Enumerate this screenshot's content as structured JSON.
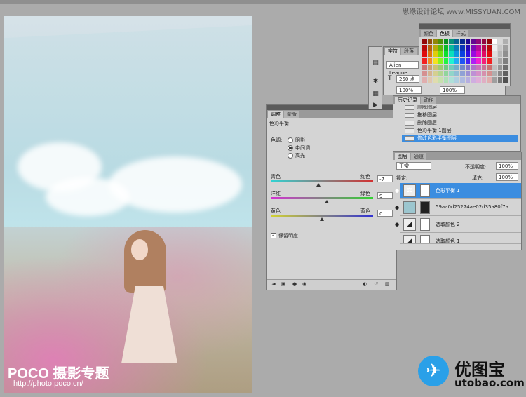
{
  "watermark_top": "思缘设计论坛 www.MISSYUAN.COM",
  "photo": {
    "watermark_brand": "POCO 摄影专题",
    "watermark_url": "http://photo.poco.cn/"
  },
  "adjustments": {
    "tabs": [
      "调整",
      "蒙版"
    ],
    "title": "色彩平衡",
    "tone_label": "色调:",
    "tones": [
      "阴影",
      "中间调",
      "高光"
    ],
    "selected_tone": "中间调",
    "sliders": [
      {
        "left": "青色",
        "right": "红色",
        "value": "-7",
        "color_left": "#31d3d3",
        "color_right": "#d33131",
        "level": -7
      },
      {
        "left": "洋红",
        "right": "绿色",
        "value": "9",
        "color_left": "#d331d3",
        "color_right": "#31d331",
        "level": 9
      },
      {
        "left": "黄色",
        "right": "蓝色",
        "value": "0",
        "color_left": "#d3d331",
        "color_right": "#3131d3",
        "level": 0
      }
    ],
    "preserve_luminosity": "保留明度",
    "preserve_checked": true
  },
  "character": {
    "tabs": [
      "字符",
      "段落"
    ],
    "font": "Alien League",
    "size": "250 点",
    "scale_v": "100%",
    "scale_h": "100%"
  },
  "swatches": {
    "tabs": [
      "颜色",
      "色板",
      "样式"
    ],
    "active_tab": "色板"
  },
  "history": {
    "tabs": [
      "历史记录",
      "动作"
    ],
    "items": [
      "删除图层",
      "拖移图层",
      "删除图层",
      "色彩平衡 1图层",
      "修改色彩平衡图层"
    ],
    "selected_index": 4
  },
  "layers": {
    "tabs": [
      "图层",
      "通道"
    ],
    "blend_mode": "正常",
    "opacity_label": "不透明度:",
    "opacity": "100%",
    "lock_label": "锁定:",
    "fill_label": "填充:",
    "fill": "100%",
    "rows": [
      {
        "name": "色彩平衡 1",
        "selected": true
      },
      {
        "name": "59aa0d25274ae02d35a80f7a",
        "selected": false
      },
      {
        "name": "选取颜色 2",
        "selected": false
      },
      {
        "name": "选取颜色 1",
        "selected": false
      }
    ]
  },
  "big_watermark": {
    "cn": "优图宝",
    "en": "utobao.com"
  }
}
